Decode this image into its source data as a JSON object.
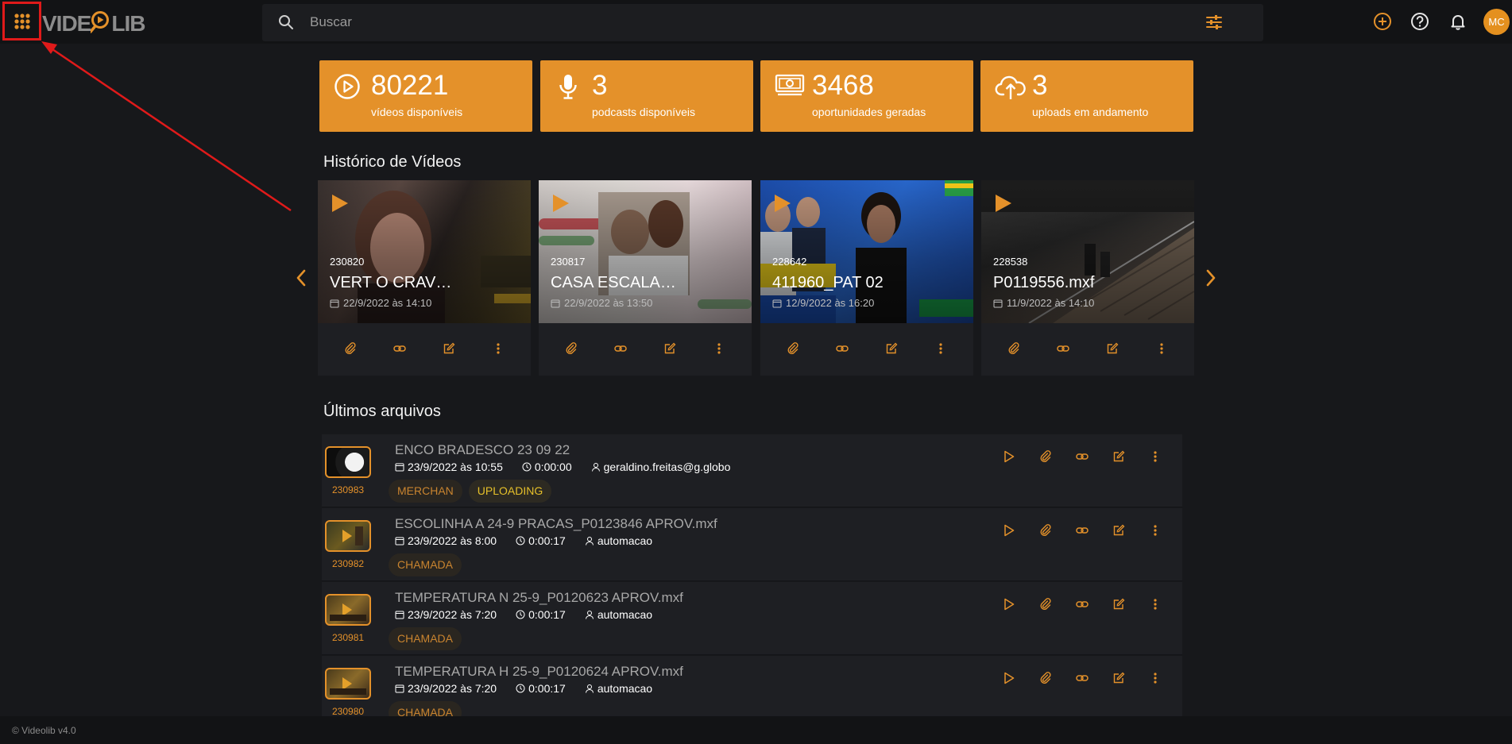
{
  "app": {
    "logo_text_left": "VIDE",
    "logo_text_right": "LIB",
    "search_placeholder": "Buscar",
    "avatar_initials": "MC",
    "accent": "#e4912a"
  },
  "stats": [
    {
      "icon": "play-circle-icon",
      "value": "80221",
      "label": "vídeos disponíveis"
    },
    {
      "icon": "microphone-icon",
      "value": "3",
      "label": "podcasts disponíveis"
    },
    {
      "icon": "money-icon",
      "value": "3468",
      "label": "oportunidades geradas"
    },
    {
      "icon": "cloud-upload-icon",
      "value": "3",
      "label": "uploads em andamento"
    }
  ],
  "history": {
    "title": "Histórico de Vídeos",
    "videos": [
      {
        "id": "230820",
        "title": "VERT O CRAV…",
        "date": "22/9/2022 às 14:10"
      },
      {
        "id": "230817",
        "title": "CASA ESCALA…",
        "date": "22/9/2022 às 13:50"
      },
      {
        "id": "228642",
        "title": "411960_PAT 02",
        "date": "12/9/2022 às 16:20"
      },
      {
        "id": "228538",
        "title": "P0119556.mxf",
        "date": "11/9/2022 às 14:10"
      }
    ]
  },
  "latest": {
    "title": "Últimos arquivos",
    "files": [
      {
        "id": "230983",
        "name": "ENCO BRADESCO 23 09 22",
        "date": "23/9/2022 às 10:55",
        "duration": "0:00:00",
        "user": "geraldino.freitas@g.globo",
        "tags": [
          "MERCHAN",
          "UPLOADING"
        ]
      },
      {
        "id": "230982",
        "name": "ESCOLINHA A 24-9 PRACAS_P0123846 APROV.mxf",
        "date": "23/9/2022 às 8:00",
        "duration": "0:00:17",
        "user": "automacao",
        "tags": [
          "CHAMADA"
        ]
      },
      {
        "id": "230981",
        "name": "TEMPERATURA N 25-9_P0120623 APROV.mxf",
        "date": "23/9/2022 às 7:20",
        "duration": "0:00:17",
        "user": "automacao",
        "tags": [
          "CHAMADA"
        ]
      },
      {
        "id": "230980",
        "name": "TEMPERATURA H 25-9_P0120624 APROV.mxf",
        "date": "23/9/2022 às 7:20",
        "duration": "0:00:17",
        "user": "automacao",
        "tags": [
          "CHAMADA"
        ]
      }
    ]
  },
  "footer": {
    "text": "© Videolib v4.0"
  }
}
